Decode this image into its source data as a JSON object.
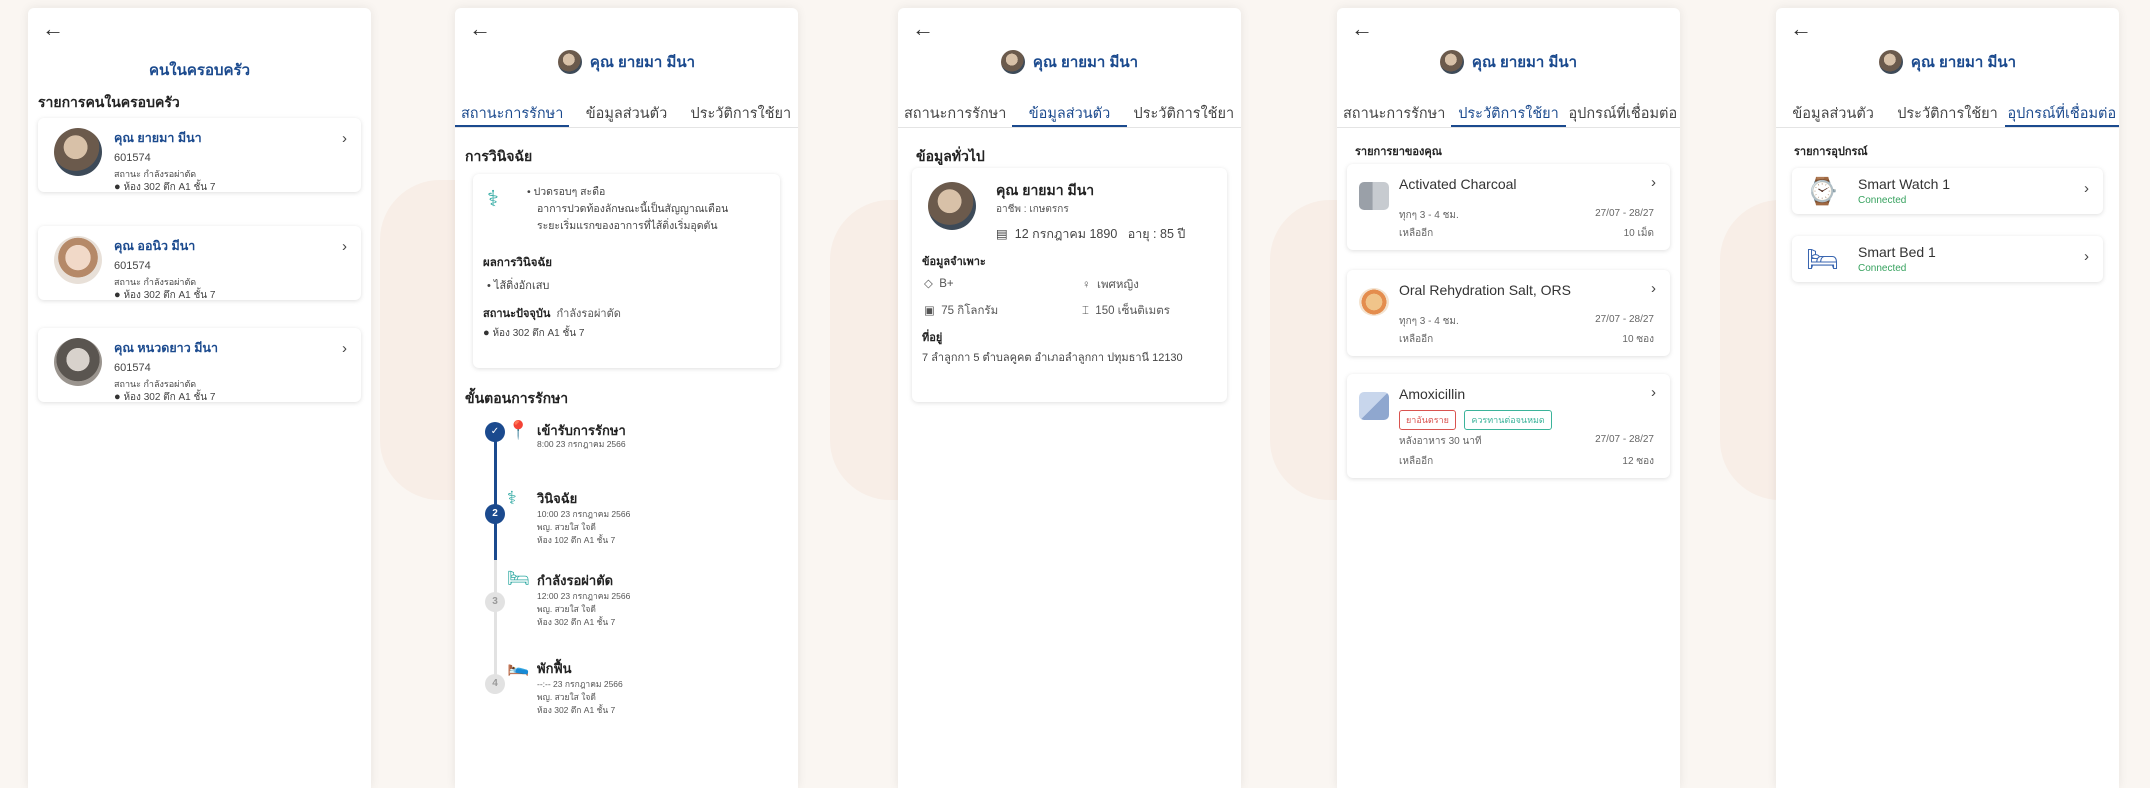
{
  "screen1": {
    "title": "คนในครอบครัว",
    "section": "รายการคนในครอบครัว",
    "members": [
      {
        "name": "คุณ ยายมา มีนา",
        "id": "601574",
        "status": "สถานะ กำลังรอผ่าตัด",
        "location": "ห้อง 302 ตึก A1 ชั้น 7"
      },
      {
        "name": "คุณ ออนิว มีนา",
        "id": "601574",
        "status": "สถานะ กำลังรอผ่าตัด",
        "location": "ห้อง 302 ตึก A1 ชั้น 7"
      },
      {
        "name": "คุณ หนวดยาว มีนา",
        "id": "601574",
        "status": "สถานะ กำลังรอผ่าตัด",
        "location": "ห้อง 302 ตึก A1 ชั้น 7"
      }
    ]
  },
  "patient": {
    "name": "คุณ ยายมา มีนา"
  },
  "screen2": {
    "tabs": [
      "สถานะการรักษา",
      "ข้อมูลส่วนตัว",
      "ประวัติการใช้ยา"
    ],
    "diagnosis_title": "การวินิจฉัย",
    "symptom_lines": [
      "ปวดรอบๆ สะดือ",
      "อาการปวดท้องลักษณะนี้เป็นสัญญาณเตือน",
      "ระยะเริ่มแรกของอาการที่ไส้ติ่งเริ่มอุดตัน"
    ],
    "result_label": "ผลการวินิจฉัย",
    "result_value": "ไส้ติ่งอักเสบ",
    "current_label": "สถานะปัจจุบัน",
    "current_value": "กำลังรอผ่าตัด",
    "location": "ห้อง 302 ตึก A1 ชั้น 7",
    "steps_title": "ขั้นตอนการรักษา",
    "steps": [
      {
        "num": "✓",
        "title": "เข้ารับการรักษา",
        "time": "8:00 23 กรกฎาคม 2566",
        "doctor": "",
        "room": ""
      },
      {
        "num": "2",
        "title": "วินิจฉัย",
        "time": "10:00 23 กรกฎาคม 2566",
        "doctor": "พญ. สวยใส ใจดี",
        "room": "ห้อง 102 ตึก A1 ชั้น 7"
      },
      {
        "num": "3",
        "title": "กำลังรอผ่าตัด",
        "time": "12:00 23 กรกฎาคม 2566",
        "doctor": "พญ. สวยใส ใจดี",
        "room": "ห้อง 302 ตึก A1 ชั้น 7"
      },
      {
        "num": "4",
        "title": "พักฟื้น",
        "time": "--:-- 23 กรกฎาคม 2566",
        "doctor": "พญ. สวยใส ใจดี",
        "room": "ห้อง 302 ตึก A1 ชั้น 7"
      }
    ],
    "step_progress": 0.5
  },
  "screen3": {
    "tabs": [
      "สถานะการรักษา",
      "ข้อมูลส่วนตัว",
      "ประวัติการใช้ยา"
    ],
    "general_title": "ข้อมูลทั่วไป",
    "occupation": "อาชีพ : เกษตรกร",
    "birthdate": "12 กรกฎาคม 1890",
    "age": "อายุ : 85 ปี",
    "specific_title": "ข้อมูลจำเพาะ",
    "blood": "B+",
    "gender": "เพศหญิง",
    "weight": "75 กิโลกรัม",
    "height": "150 เซ็นติเมตร",
    "address_title": "ที่อยู่",
    "address": "7 ลำลูกกา 5 ตำบลคูคต อำเภอลำลูกกา ปทุมธานี 12130"
  },
  "screen4": {
    "tabs": [
      "สถานะการรักษา",
      "ประวัติการใช้ยา",
      "อุปกรณ์ที่เชื่อมต่อ"
    ],
    "section": "รายการยาของคุณ",
    "meds": [
      {
        "name": "Activated Charcoal",
        "dose": "ทุกๆ 3 - 4 ชม.",
        "range": "27/07 - 28/27",
        "remain_label": "เหลืออีก",
        "remain": "10 เม็ด",
        "tags": []
      },
      {
        "name": "Oral Rehydration Salt, ORS",
        "dose": "ทุกๆ 3 - 4 ชม.",
        "range": "27/07 - 28/27",
        "remain_label": "เหลืออีก",
        "remain": "10 ซอง",
        "tags": []
      },
      {
        "name": "Amoxicillin",
        "dose": "หลังอาหาร 30 นาที",
        "range": "27/07 - 28/27",
        "remain_label": "เหลืออีก",
        "remain": "12 ซอง",
        "tags": [
          "ยาอันตราย",
          "ควรทานต่อจนหมด"
        ]
      }
    ]
  },
  "screen5": {
    "tabs": [
      "ข้อมูลส่วนตัว",
      "ประวัติการใช้ยา",
      "อุปกรณ์ที่เชื่อมต่อ"
    ],
    "section": "รายการอุปกรณ์",
    "devices": [
      {
        "name": "Smart Watch 1",
        "status": "Connected"
      },
      {
        "name": "Smart Bed 1",
        "status": "Connected"
      }
    ]
  },
  "colors": {
    "primary": "#1b4a8e",
    "connected": "#37a25f",
    "danger": "#d9534f",
    "info": "#3bb39a"
  }
}
